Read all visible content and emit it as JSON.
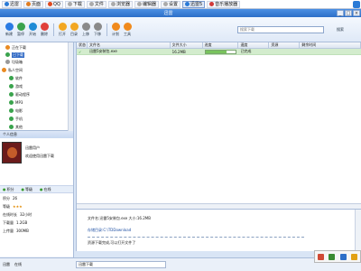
{
  "taskbar": {
    "items": [
      {
        "label": "迅雷"
      },
      {
        "label": "页面"
      },
      {
        "label": "QQ"
      },
      {
        "label": "下载"
      },
      {
        "label": "文件"
      },
      {
        "label": "浏览器"
      },
      {
        "label": "编辑器"
      },
      {
        "label": "设置"
      },
      {
        "label": "迅雷5"
      },
      {
        "label": "音乐播放器"
      }
    ]
  },
  "window": {
    "title": "迅雷",
    "min": "_",
    "max": "□",
    "close": "×"
  },
  "toolbar": {
    "buttons": [
      {
        "label": "新建",
        "color": "#2b7be3"
      },
      {
        "label": "暂停",
        "color": "#3aa34d"
      },
      {
        "label": "开始",
        "color": "#1e8bd6"
      },
      {
        "label": "删除",
        "color": "#e0403a"
      },
      {
        "label": "打开",
        "color": "#f2a722"
      },
      {
        "label": "目录",
        "color": "#f2a722"
      },
      {
        "label": "上移",
        "color": "#8a8a8a"
      },
      {
        "label": "下移",
        "color": "#8a8a8a"
      },
      {
        "label": "计划",
        "color": "#f08a1d"
      },
      {
        "label": "工具",
        "color": "#f08a1d"
      }
    ],
    "search_placeholder": "搜索下载",
    "search_button": "搜索"
  },
  "tree": {
    "items": [
      {
        "label": "正在下载"
      },
      {
        "label": "已下载"
      },
      {
        "label": "垃圾箱"
      },
      {
        "label": "私人空间"
      },
      {
        "label": "软件"
      },
      {
        "label": "游戏"
      },
      {
        "label": "驱动程序"
      },
      {
        "label": "MP3"
      },
      {
        "label": "电影"
      },
      {
        "label": "手机"
      },
      {
        "label": "其他"
      }
    ]
  },
  "profile": {
    "header": "个人信息",
    "name": "迅雷用户",
    "desc": "欢迎使用迅雷下载",
    "stats": [
      "积分",
      "等级",
      "在线"
    ],
    "rows": [
      {
        "key": "积分",
        "value": "26"
      },
      {
        "key": "等级",
        "value": "★★★"
      },
      {
        "key": "在线时长",
        "value": "32小时"
      },
      {
        "key": "下载量",
        "value": "1.2GB"
      },
      {
        "key": "上传量",
        "value": "300MB"
      }
    ]
  },
  "table": {
    "headers": [
      "状态",
      "文件名",
      "文件大小",
      "进度",
      "速度",
      "资源",
      "剩余时间"
    ],
    "rows": [
      {
        "status": "✓",
        "filename": "迅雷5安装包.exe",
        "size": "16.2MB",
        "progress": 70,
        "speed": "已完成",
        "resources": "",
        "remaining": ""
      }
    ]
  },
  "info_pane": {
    "lines": [
      "文件名:迅雷5安装包.exe 大小:16.2MB",
      "存储目录:C:\\TDDownload",
      "资源下载完成,可以打开文件了"
    ]
  },
  "status": {
    "left": [
      "迅雷",
      "在线"
    ],
    "input_value": "迅雷下载"
  },
  "tray": {
    "icons": [
      {
        "name": "input-method",
        "color": "#d04a36"
      },
      {
        "name": "network",
        "color": "#3a8b32"
      },
      {
        "name": "volume",
        "color": "#2d6fc8"
      },
      {
        "name": "security",
        "color": "#e2a114"
      }
    ]
  }
}
